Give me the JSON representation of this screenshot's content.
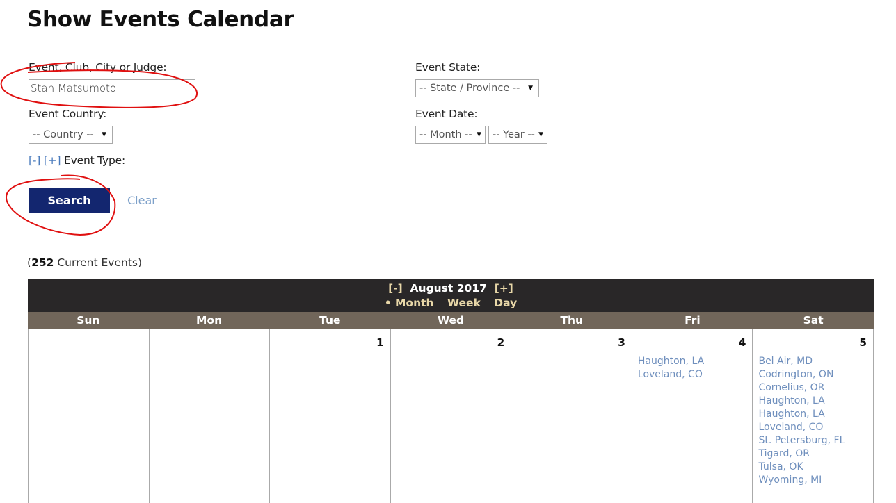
{
  "page": {
    "title": "Show Events Calendar"
  },
  "filters": {
    "search_label": "Event, Club, City or Judge:",
    "search_value": "Stan Matsumoto",
    "state_label": "Event State:",
    "state_selected": "-- State / Province --",
    "country_label": "Event Country:",
    "country_selected": "-- Country --",
    "date_label": "Event Date:",
    "month_selected": "-- Month --",
    "year_selected": "-- Year --",
    "collapse_label": "[-]",
    "expand_label": "[+]",
    "event_type_label": "Event Type:",
    "search_button": "Search",
    "clear_link": "Clear"
  },
  "summary": {
    "open_paren": "(",
    "count": "252",
    "count_label": " Current Events)"
  },
  "calendar": {
    "prev_label": "[-]",
    "next_label": "[+]",
    "month_title": "August 2017",
    "views": [
      "• Month",
      "Week",
      "Day"
    ],
    "days_of_week": [
      "Sun",
      "Mon",
      "Tue",
      "Wed",
      "Thu",
      "Fri",
      "Sat"
    ],
    "week": [
      {
        "day": "",
        "events": []
      },
      {
        "day": "",
        "events": []
      },
      {
        "day": "1",
        "events": []
      },
      {
        "day": "2",
        "events": []
      },
      {
        "day": "3",
        "events": []
      },
      {
        "day": "4",
        "events": [
          "Haughton, LA",
          "Loveland, CO"
        ]
      },
      {
        "day": "5",
        "events": [
          "Bel Air, MD",
          "Codrington, ON",
          "Cornelius, OR",
          "Haughton, LA",
          "Haughton, LA",
          "Loveland, CO",
          "St. Petersburg, FL",
          "Tigard, OR",
          "Tulsa, OK",
          "Wyoming, MI"
        ]
      }
    ]
  },
  "colors": {
    "primary_button": "#13266f",
    "calendar_header": "#292728",
    "dow_header": "#71665a",
    "nav_accent": "#e8d7a8",
    "link": "#6f8fbd",
    "annotation": "#e01010"
  }
}
